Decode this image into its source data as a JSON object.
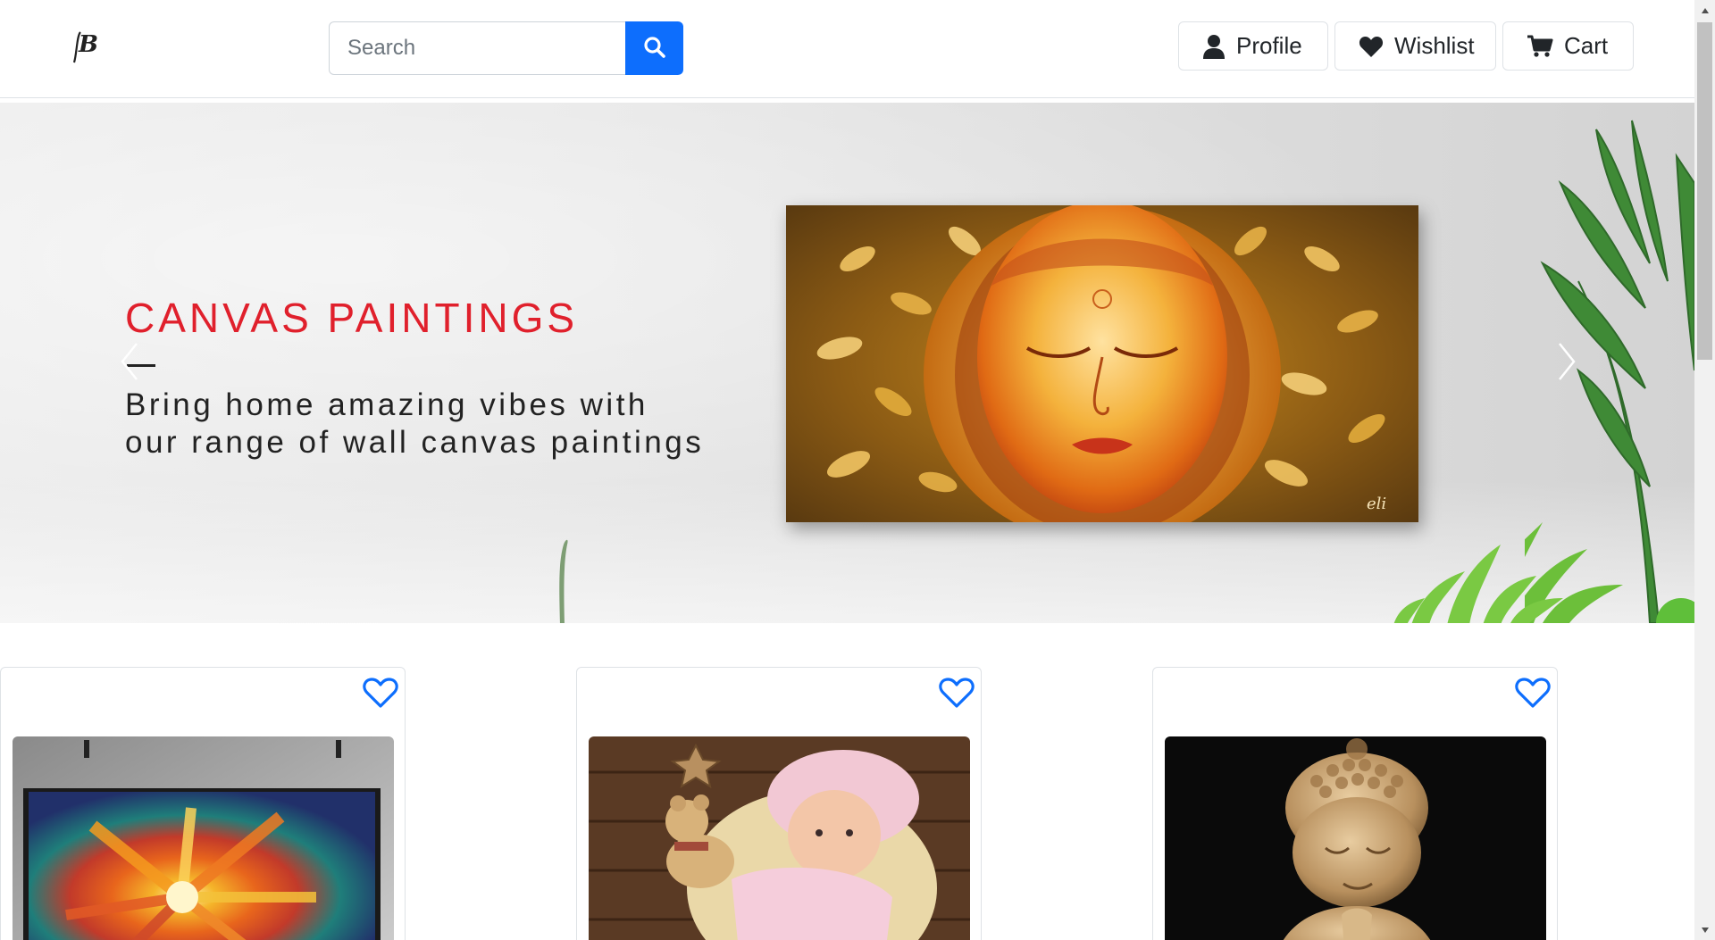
{
  "header": {
    "logo_text": "B",
    "search": {
      "placeholder": "Search",
      "value": ""
    },
    "nav": {
      "profile_label": "Profile",
      "wishlist_label": "Wishlist",
      "cart_label": "Cart"
    }
  },
  "hero": {
    "title": "CANVAS PAINTINGS",
    "subtitle_line1": "Bring home amazing vibes with",
    "subtitle_line2": "our range of wall canvas paintings",
    "painting_signature": "eli"
  },
  "products": [
    {
      "image": "abstract-flower-canvas-painting",
      "wishlisted": false
    },
    {
      "image": "knitted-doll-with-teddy-bear",
      "wishlisted": false
    },
    {
      "image": "baby-buddha-statue",
      "wishlisted": false
    }
  ],
  "colors": {
    "primary": "#0d6efd",
    "hero_title": "#e0202c",
    "heart_outline": "#0d6efd"
  },
  "icons": {
    "search": "search-icon",
    "profile": "user-icon",
    "wishlist": "heart-icon",
    "cart": "cart-icon",
    "prev": "chevron-left-icon",
    "next": "chevron-right-icon"
  }
}
